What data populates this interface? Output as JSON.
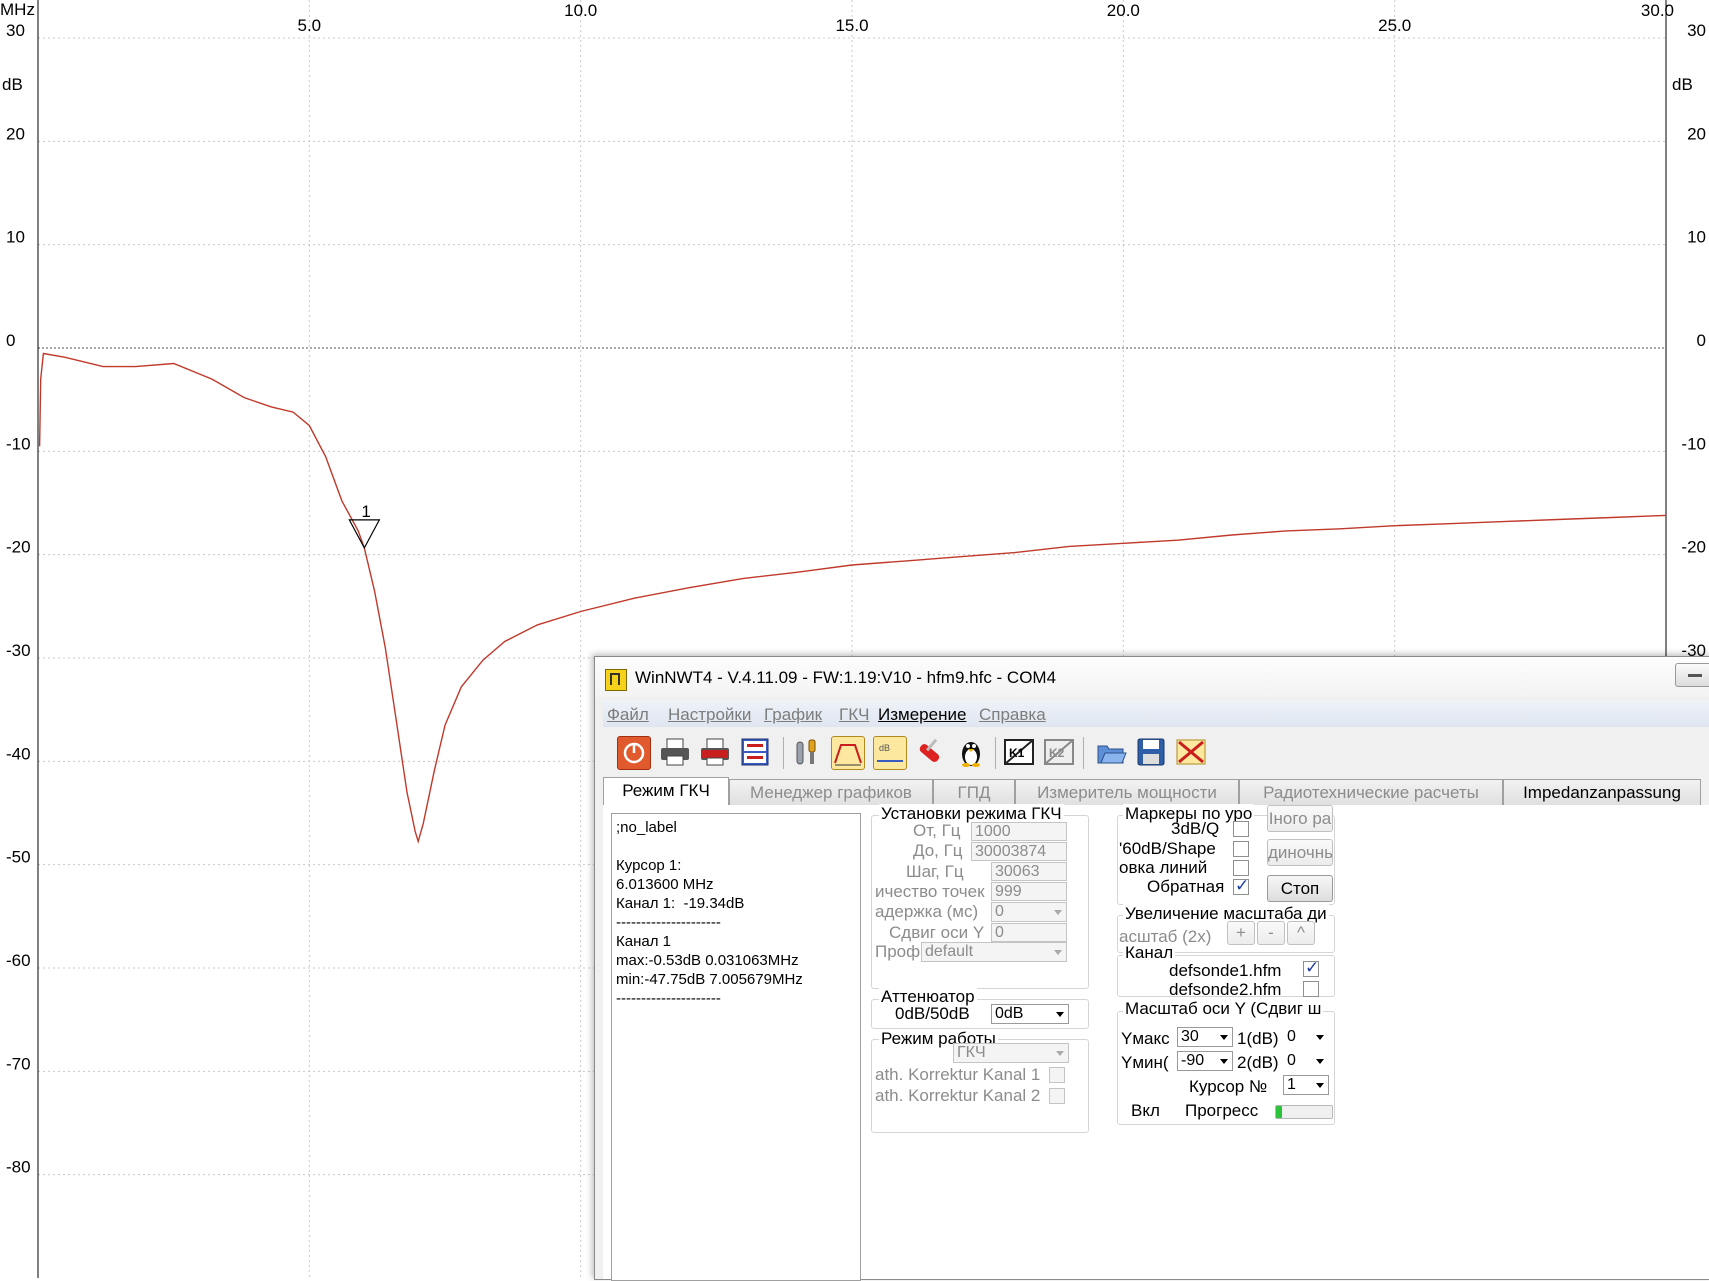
{
  "chart_data": {
    "type": "line",
    "xlabel": "MHz",
    "ylabel": "dB",
    "xlim": [
      0.0,
      30.0
    ],
    "ylim": [
      -90,
      30
    ],
    "x_ticks": [
      {
        "value": 5.0,
        "label": "5.0",
        "row": 2
      },
      {
        "value": 10.0,
        "label": "10.0",
        "row": 1
      },
      {
        "value": 15.0,
        "label": "15.0",
        "row": 2
      },
      {
        "value": 20.0,
        "label": "20.0",
        "row": 1
      },
      {
        "value": 25.0,
        "label": "25.0",
        "row": 2
      },
      {
        "value": 30.0,
        "label": "30.0",
        "row": 1
      }
    ],
    "y_ticks": [
      30,
      20,
      10,
      0,
      -10,
      -20,
      -30,
      -40,
      -50,
      -60,
      -70,
      -80
    ],
    "y_tick_labels": [
      "30",
      "20",
      "10",
      "0",
      "-10",
      "-20",
      "-30",
      "-40",
      "-50",
      "-60",
      "-70",
      "-80"
    ],
    "grid": true,
    "line_color": "#c0392b",
    "series": [
      {
        "x": [
          0.03,
          0.05,
          0.1,
          0.5,
          1.2,
          1.8,
          2.5,
          3.2,
          3.8,
          4.3,
          4.7,
          5.0,
          5.3,
          5.6,
          5.9,
          6.013,
          6.2,
          6.4,
          6.6,
          6.8,
          6.95,
          7.006,
          7.1,
          7.3,
          7.5,
          7.8,
          8.2,
          8.6,
          9.2,
          10.0,
          11.0,
          12.0,
          13.0,
          14.0,
          15.0,
          16.0,
          17.0,
          18.0,
          19.0,
          20.0,
          21.0,
          22.0,
          23.0,
          24.0,
          25.0,
          26.0,
          27.0,
          28.0,
          29.0,
          30.0
        ],
        "y": [
          -9.5,
          -3.0,
          -0.53,
          -0.9,
          -1.8,
          -1.8,
          -1.5,
          -3.0,
          -4.8,
          -5.7,
          -6.2,
          -7.5,
          -10.5,
          -14.8,
          -17.7,
          -19.34,
          -23.5,
          -29.0,
          -36.0,
          -43.0,
          -46.8,
          -47.75,
          -46.0,
          -41.0,
          -36.5,
          -32.8,
          -30.2,
          -28.4,
          -26.8,
          -25.5,
          -24.2,
          -23.2,
          -22.3,
          -21.7,
          -21.0,
          -20.6,
          -20.2,
          -19.8,
          -19.2,
          -18.9,
          -18.6,
          -18.1,
          -17.7,
          -17.5,
          -17.2,
          -17.0,
          -16.8,
          -16.6,
          -16.4,
          -16.2
        ]
      }
    ],
    "marker": {
      "label": "1",
      "x": 6.0136,
      "y": -19.34
    }
  },
  "window": {
    "title": "WinNWT4 - V.4.11.09 - FW:1.19:V10 - hfm9.hfc - COM4",
    "menu": [
      "Файл",
      "Настройки",
      "График",
      "ГКЧ",
      "Измерение",
      "Справка"
    ],
    "menu_active_index": 4,
    "toolbar_icons": [
      "power-icon",
      "printer-icon",
      "pdf-icon",
      "png-bmp-icon",
      "calibration-tools-icon",
      "chart-view-icon",
      "db-scale-icon",
      "swiss-knife-icon",
      "linux-penguin-icon",
      "k1-channel-icon",
      "k2-channel-icon",
      "open-folder-icon",
      "save-disk-icon",
      "delete-chart-icon"
    ],
    "tabs": [
      "Режим ГКЧ",
      "Менеджер графиков",
      "ГПД",
      "Измеритель мощности",
      "Радиотехнические расчеты",
      "Impedanzanpassung"
    ],
    "info_text": ";no_label\n\nКурсор 1:\n6.013600 MHz\nКанал 1:  -19.34dB\n---------------------\nКанал 1\nmax:-0.53dB 0.031063MHz\nmin:-47.75dB 7.005679MHz\n---------------------",
    "sweep": {
      "title": "Установки режима ГКЧ",
      "from_label": "От, Гц",
      "from_value": "1000",
      "to_label": "До, Гц",
      "to_value": "30003874",
      "step_label": "Шаг, Гц",
      "step_value": "30063",
      "points_label": "ичество точек",
      "points_value": "999",
      "delay_label": "адержка (мс)",
      "delay_value": "0",
      "yshift_label": "Сдвиг оси Y",
      "yshift_value": "0",
      "profile_label": "Проф",
      "profile_value": "default"
    },
    "attenuator": {
      "title": "Аттенюатор",
      "label": "0dB/50dB",
      "value": "0dB"
    },
    "mode": {
      "title": "Режим работы",
      "value": "ГКЧ",
      "korr1": "ath. Korrektur Kanal 1",
      "korr2": "ath. Korrektur Kanal 2"
    },
    "markers": {
      "title": "Маркеры по уро",
      "q": "3dB/Q",
      "shape": "'60dB/Shape",
      "lines": "овка линий",
      "inverse": "Обратная",
      "btn1": "Iного ра",
      "btn2": "диночнь",
      "stop": "Стоп"
    },
    "zoom": {
      "title": "Увеличение масштаба ди",
      "label": "асштаб (2х)",
      "plus": "+",
      "minus": "-",
      "up": "^"
    },
    "channel": {
      "title": "Канал",
      "ch1": "defsonde1.hfm",
      "ch2": "defsonde2.hfm"
    },
    "yscale": {
      "title": "Масштаб оси Y (Сдвиг ш",
      "ymax_label": "Yмакс",
      "ymax_value": "30",
      "ymin_label": "Yмин(",
      "ymin_value": "-90",
      "ch1_label": "1(dB)",
      "ch1_value": "0",
      "ch2_label": "2(dB)",
      "ch2_value": "0",
      "cursor_label": "Курсор №",
      "cursor_value": "1",
      "on_label": "Вкл",
      "progress_label": "Прогресс",
      "progress": 0.1
    }
  }
}
